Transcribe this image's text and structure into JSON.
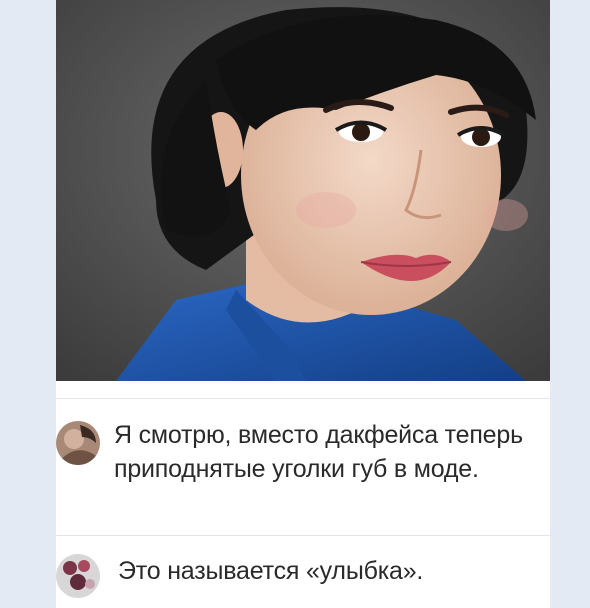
{
  "post": {
    "photo_icon": "portrait-photo"
  },
  "comments": [
    {
      "avatar_icon": "user-avatar",
      "text": "Я смотрю, вместо дакфейса теперь приподнятые уголки губ в моде."
    },
    {
      "avatar_icon": "user-avatar",
      "text": "Это называется «улыбка»."
    }
  ],
  "colors": {
    "page_background": "#e3eaf3",
    "card_background": "#ffffff",
    "text": "#2a2a2a",
    "divider": "#e1e5ea"
  }
}
